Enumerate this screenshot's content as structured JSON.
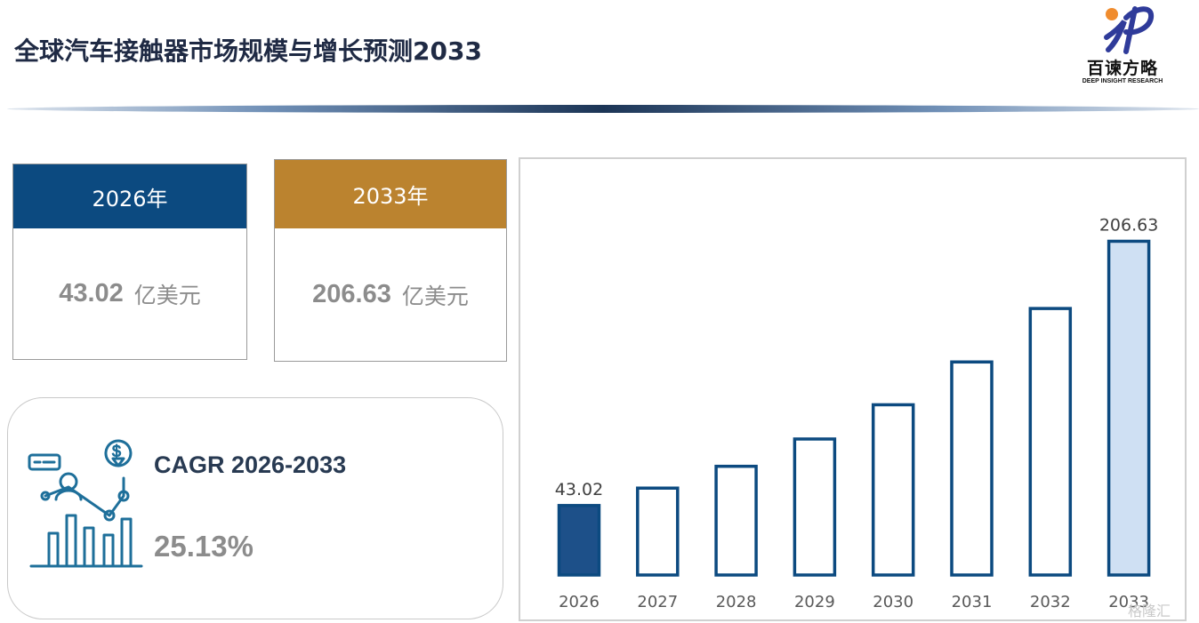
{
  "header": {
    "title": "全球汽车接触器市场规模与增长预测2033"
  },
  "logo": {
    "name": "百谏方略",
    "sub": "DEEP INSIGHT RESEARCH"
  },
  "cards": {
    "start": {
      "year_label": "2026年",
      "value": "43.02",
      "unit": "亿美元",
      "color": "#0c4a80"
    },
    "end": {
      "year_label": "2033年",
      "value": "206.63",
      "unit": "亿美元",
      "color": "#bb832f"
    }
  },
  "cagr": {
    "label": "CAGR 2026-2033",
    "value": "25.13%"
  },
  "watermark": "格隆汇",
  "chart_data": {
    "type": "bar",
    "categories": [
      "2026",
      "2027",
      "2028",
      "2029",
      "2030",
      "2031",
      "2032",
      "2033"
    ],
    "values": [
      43.02,
      53.8,
      67.3,
      84.2,
      105.4,
      131.9,
      165.0,
      206.63
    ],
    "data_labels": [
      "43.02",
      "",
      "",
      "",
      "",
      "",
      "",
      "206.63"
    ],
    "ylim": [
      0,
      230
    ],
    "grid": false,
    "colors": {
      "outline": "#0c4a80",
      "first_fill": "#1d5089",
      "last_fill": "#cfe0f3",
      "middle_fill": "#ffffff",
      "axis_label": "#595959",
      "data_label": "#404040"
    }
  }
}
